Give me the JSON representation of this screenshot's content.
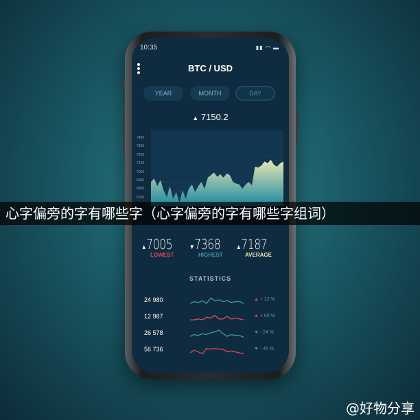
{
  "status": {
    "time": "10:35",
    "icons": "signal-wifi-battery"
  },
  "header": {
    "title": "BTC / USD",
    "menu_icon": "more-vertical-icon"
  },
  "tabs": [
    {
      "label": "YEAR"
    },
    {
      "label": "MONTH"
    },
    {
      "label": "DAY",
      "active": true
    }
  ],
  "price": {
    "arrow": "▲",
    "value": "7150.2"
  },
  "chart_data": {
    "type": "area",
    "y_ticks": [
      "7400",
      "7300",
      "7200",
      "7100",
      "7000",
      "6900",
      "6800",
      "6700"
    ],
    "ylim": [
      6650,
      7450
    ],
    "values": [
      6900,
      6940,
      6850,
      6920,
      6800,
      6720,
      6850,
      6700,
      6780,
      6650,
      6800,
      6700,
      6820,
      6870,
      6780,
      6850,
      6900,
      6820,
      6950,
      6980,
      7010,
      6960,
      6990,
      6950,
      7000,
      6980,
      6900,
      6880,
      6870,
      6820,
      6870,
      6900,
      6860,
      7080,
      7070,
      7090,
      7140,
      7120,
      7160,
      7100,
      7080,
      7120,
      7140
    ],
    "colors": {
      "top": "#e8e6b4",
      "bottom": "#1b8aa0"
    }
  },
  "summary": [
    {
      "arrow": "▲",
      "value": "7005",
      "label": "LOWEST",
      "color": "#e0485a"
    },
    {
      "arrow": "▼",
      "value": "7368",
      "label": "HIGHEST",
      "color": "#3e9aa8"
    },
    {
      "arrow": "▲",
      "value": "7187",
      "label": "AVERAGE",
      "color": "#e8e6b4"
    }
  ],
  "statistics": {
    "title": "STATISTICS",
    "rows": [
      {
        "value": "24 980",
        "arrow": "▲",
        "change": "+ 12 %",
        "color": "#3e9aa8",
        "spark": [
          3,
          5,
          4,
          6,
          3,
          9,
          6,
          7,
          5,
          6,
          4,
          5,
          5,
          3
        ]
      },
      {
        "value": "12 987",
        "arrow": "▲",
        "change": "+ 65 %",
        "color": "#e0485a",
        "spark": [
          3,
          3,
          4,
          3,
          6,
          5,
          8,
          4,
          4,
          7,
          4,
          5,
          4,
          3
        ]
      },
      {
        "value": "26 578",
        "arrow": "▼",
        "change": "- 24 %",
        "color": "#3e9aa8",
        "spark": [
          3,
          5,
          4,
          6,
          5,
          7,
          8,
          10,
          6,
          3,
          5,
          4,
          4,
          2
        ]
      },
      {
        "value": "56 736",
        "arrow": "▼",
        "change": "- 45 %",
        "color": "#e0485a",
        "spark": [
          3,
          6,
          4,
          2,
          8,
          7,
          8,
          7,
          7,
          4,
          5,
          4,
          3,
          2
        ]
      }
    ]
  },
  "banner": {
    "text": "心字偏旁的字有哪些字（心字偏旁的字有哪些字组词）"
  },
  "watermark": "@好物分享"
}
